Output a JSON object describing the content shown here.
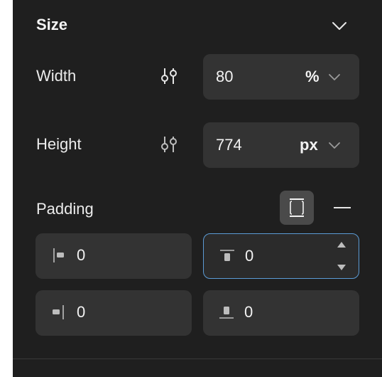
{
  "section": {
    "title": "Size"
  },
  "width": {
    "label": "Width",
    "value": "80",
    "unit": "%"
  },
  "height": {
    "label": "Height",
    "value": "774",
    "unit": "px"
  },
  "padding": {
    "label": "Padding",
    "left": "0",
    "top": "0",
    "right": "0",
    "bottom": "0"
  },
  "colors": {
    "accent": "#5b9bd5",
    "field_bg": "#333333",
    "panel_bg": "#1f1f1f"
  }
}
